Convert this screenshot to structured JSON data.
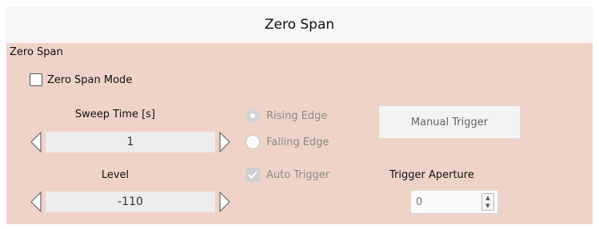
{
  "window": {
    "title": "Zero Span"
  },
  "group": {
    "label": "Zero Span"
  },
  "zero_span_mode": {
    "label": "Zero Span Mode",
    "checked": false
  },
  "sweep_time": {
    "label": "Sweep Time [s]",
    "value": "1"
  },
  "level": {
    "label": "Level",
    "value": "-110"
  },
  "trigger_edge": {
    "rising_label": "Rising Edge",
    "falling_label": "Falling Edge",
    "selected": "Rising Edge"
  },
  "auto_trigger": {
    "label": "Auto Trigger",
    "checked": true
  },
  "manual_trigger": {
    "label": "Manual Trigger"
  },
  "trigger_aperture": {
    "label": "Trigger Aperture",
    "value": "0"
  },
  "icons": {
    "left_arrow": "left-arrow-icon",
    "right_arrow": "right-arrow-icon",
    "spin_up": "chevron-up-icon",
    "spin_down": "chevron-down-icon",
    "check": "check-icon"
  },
  "colors": {
    "panel_bg": "#efd3c8",
    "title_bg": "#f6f6f6",
    "disabled_text": "#8a8a8a"
  }
}
